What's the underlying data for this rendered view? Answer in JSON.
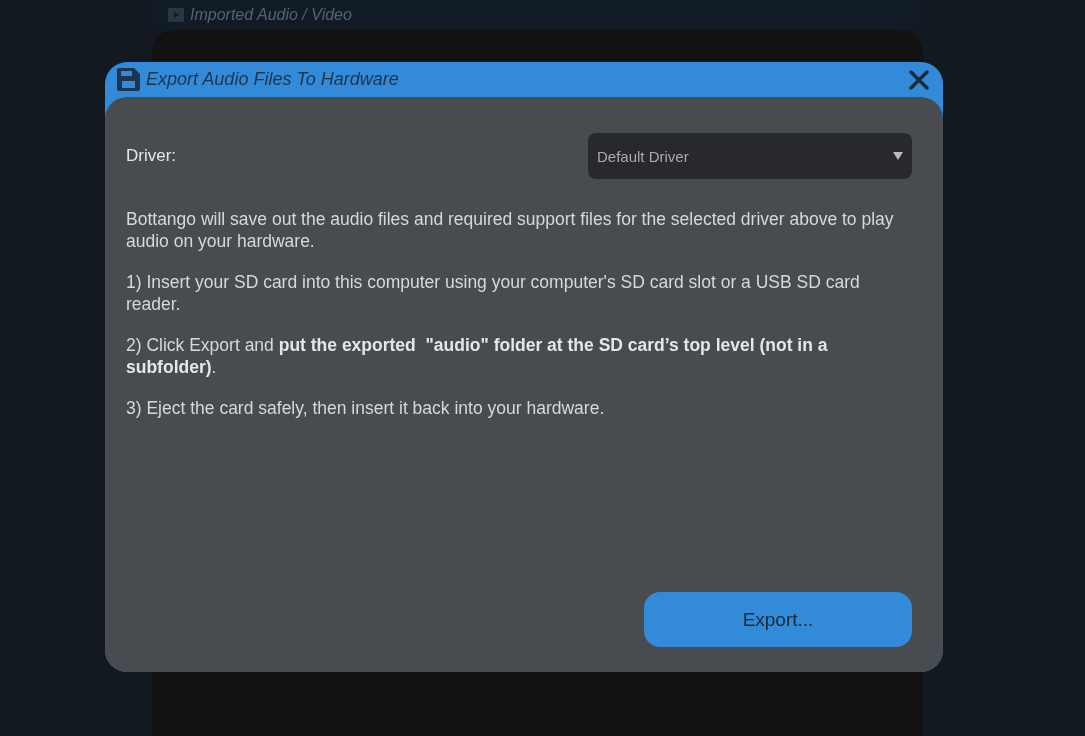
{
  "background": {
    "header": {
      "title": "Imported Audio / Video"
    }
  },
  "dialog": {
    "title": "Export Audio Files To Hardware",
    "driver": {
      "label": "Driver:",
      "value": "Default Driver"
    },
    "paragraphs": [
      "Bottango will save out the audio files and required support files for the selected driver above to play audio on your hardware.",
      "1) Insert your SD card into this computer using your computer's SD card slot or a USB SD card reader.",
      "2) Click Export and **put the exported  \"audio\" folder at the SD card’s top level (not in a subfolder)**.",
      "3) Eject the card safely, then insert it back into your hardware."
    ],
    "buttons": [
      {
        "label": "Export..."
      }
    ]
  }
}
